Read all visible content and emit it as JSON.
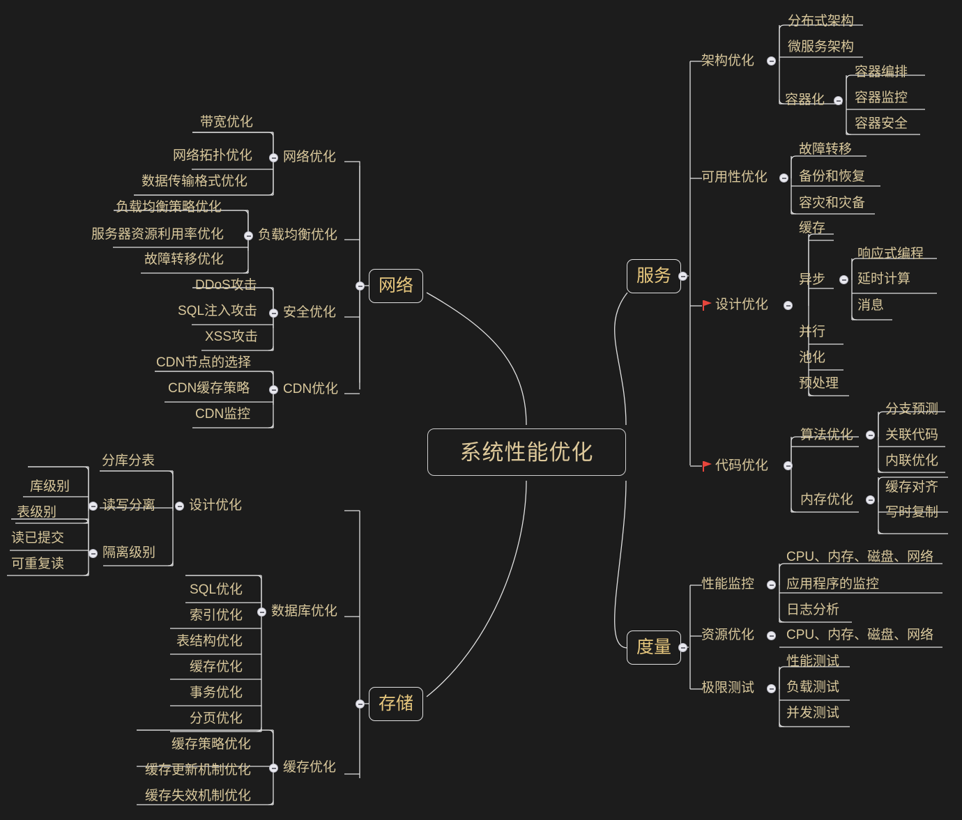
{
  "theme": {
    "background": "#1c1c1c",
    "text_color": "#d9c89c",
    "branch_text_color": "#e8c87e",
    "line_color": "#e2e2e2",
    "flag_color": "#e8453c"
  },
  "central": {
    "label": "系统性能优化"
  },
  "branches": [
    {
      "id": "network",
      "label": "网络"
    },
    {
      "id": "storage",
      "label": "存储"
    },
    {
      "id": "service",
      "label": "服务"
    },
    {
      "id": "metric",
      "label": "度量"
    }
  ],
  "nodes": {
    "network_opt": "网络优化",
    "bandwidth_opt": "带宽优化",
    "topology_opt": "网络拓扑优化",
    "data_transfer_format_opt": "数据传输格式优化",
    "load_balance_opt": "负载均衡优化",
    "lb_strategy_opt": "负载均衡策略优化",
    "server_resource_util_opt": "服务器资源利用率优化",
    "failover_opt": "故障转移优化",
    "security_opt": "安全优化",
    "ddos_attack": "DDoS攻击",
    "sql_injection": "SQL注入攻击",
    "xss_attack": "XSS攻击",
    "cdn_opt": "CDN优化",
    "cdn_node_select": "CDN节点的选择",
    "cdn_cache_strategy": "CDN缓存策略",
    "cdn_monitor": "CDN监控",
    "design_opt_db": "设计优化",
    "sharding": "分库分表",
    "read_write_split": "读写分离",
    "db_level": "库级别",
    "table_level": "表级别",
    "isolation_level": "隔离级别",
    "read_committed": "读已提交",
    "repeatable_read": "可重复读",
    "database_opt": "数据库优化",
    "sql_opt": "SQL优化",
    "index_opt": "索引优化",
    "table_struct_opt": "表结构优化",
    "cache_opt_db": "缓存优化",
    "transaction_opt": "事务优化",
    "pagination_opt": "分页优化",
    "cache_opt": "缓存优化",
    "cache_strategy_opt": "缓存策略优化",
    "cache_update_opt": "缓存更新机制优化",
    "cache_invalidate_opt": "缓存失效机制优化",
    "arch_opt": "架构优化",
    "distributed_arch": "分布式架构",
    "microservice_arch": "微服务架构",
    "containerization": "容器化",
    "container_orchestration": "容器编排",
    "container_monitoring": "容器监控",
    "container_security": "容器安全",
    "availability_opt": "可用性优化",
    "failover": "故障转移",
    "backup_restore": "备份和恢复",
    "disaster_recovery": "容灾和灾备",
    "design_opt": "设计优化",
    "cache": "缓存",
    "async": "异步",
    "reactive_programming": "响应式编程",
    "lazy_computation": "延时计算",
    "message": "消息",
    "parallel": "并行",
    "pooling": "池化",
    "preprocessing": "预处理",
    "code_opt": "代码优化",
    "algorithm_opt": "算法优化",
    "branch_prediction": "分支预测",
    "related_code": "关联代码",
    "inline_opt": "内联优化",
    "memory_opt": "内存优化",
    "cache_align": "缓存对齐",
    "copy_on_write": "写时复制",
    "perf_monitor": "性能监控",
    "cpu_mem_disk_net_1": "CPU、内存、磁盘、网络",
    "app_monitoring": "应用程序的监控",
    "log_analysis": "日志分析",
    "resource_opt": "资源优化",
    "cpu_mem_disk_net_2": "CPU、内存、磁盘、网络",
    "limit_test": "极限测试",
    "perf_test": "性能测试",
    "load_test": "负载测试",
    "concurrency_test": "并发测试"
  },
  "flags": {
    "design_opt": "red-flag",
    "code_opt": "red-flag"
  }
}
